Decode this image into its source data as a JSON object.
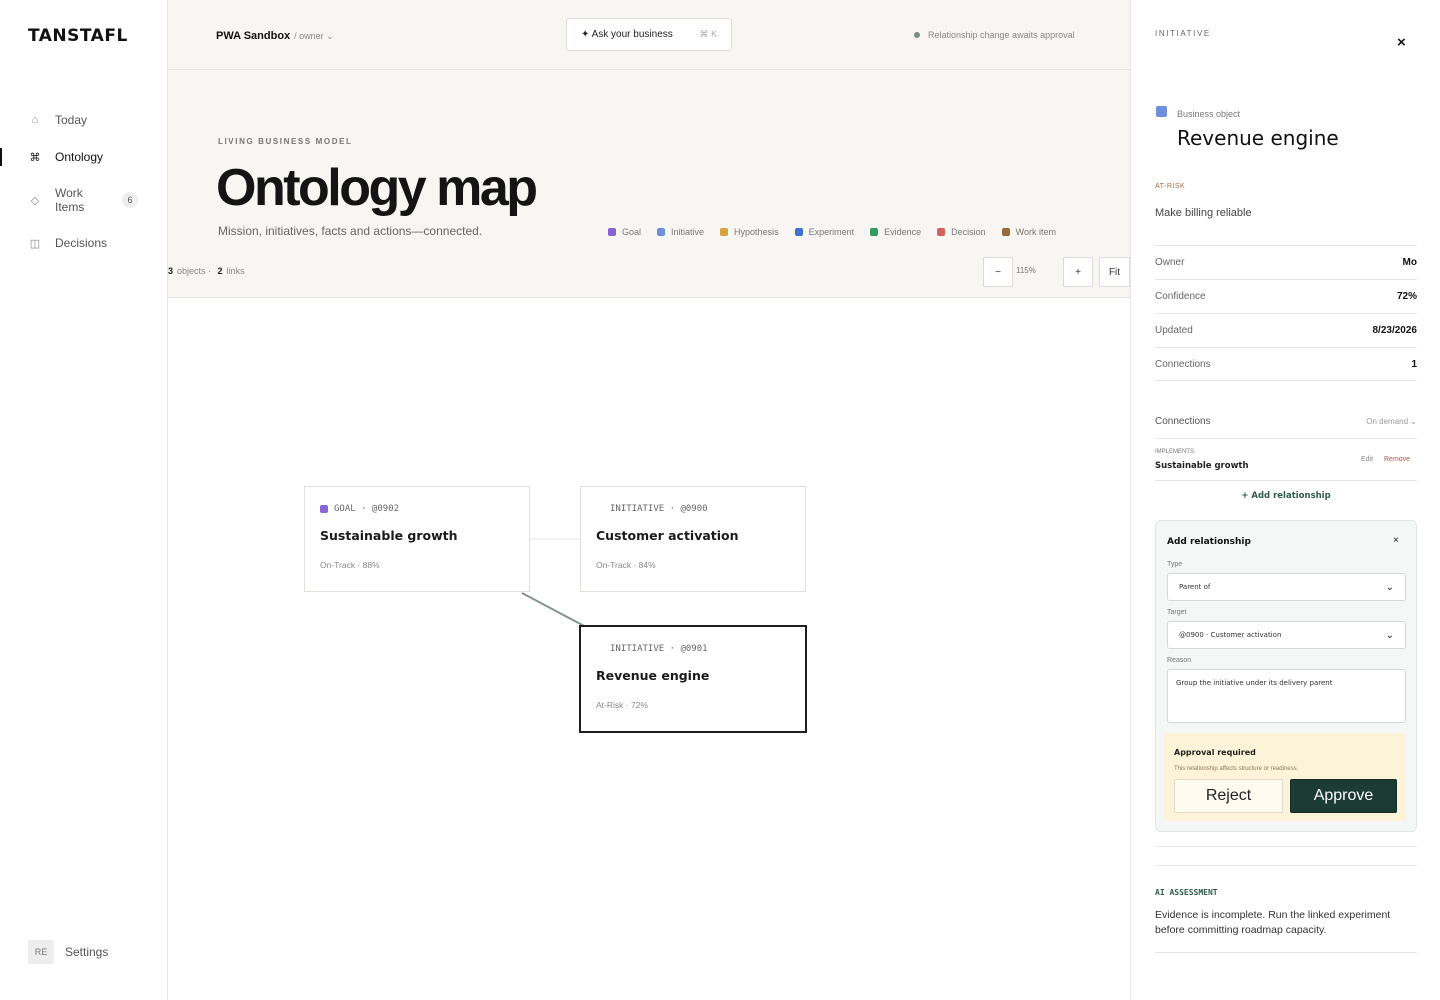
{
  "app": {
    "logo": "TANSTAFL"
  },
  "sidebar": {
    "items": [
      {
        "label": "Today",
        "icon": "home-icon",
        "glyph": "⌂"
      },
      {
        "label": "Ontology",
        "icon": "command-icon",
        "glyph": "⌘"
      },
      {
        "label_line1": "Work",
        "label_line2": "Items",
        "icon": "diamond-icon",
        "glyph": "◇",
        "badge": "6"
      },
      {
        "label": "Decisions",
        "icon": "book-icon",
        "glyph": "◫"
      }
    ],
    "active": "Ontology",
    "settings": {
      "avatar": "RE",
      "label": "Settings"
    }
  },
  "topbar": {
    "workspace": "PWA Sandbox",
    "role": "/ owner ⌄",
    "ask_label": "✦ Ask your business",
    "ask_kbd": "⌘ K",
    "status": "Relationship change awaits approval",
    "status_color": "#7a8f85"
  },
  "page": {
    "kicker": "LIVING BUSINESS MODEL",
    "title": "Ontology map",
    "subtitle": "Mission, initiatives, facts and actions—connected."
  },
  "legend": [
    {
      "label": "Goal",
      "color": "#8a63d6"
    },
    {
      "label": "Initiative",
      "color": "#6f8fdc"
    },
    {
      "label": "Hypothesis",
      "color": "#d8a23c"
    },
    {
      "label": "Experiment",
      "color": "#3d73c9"
    },
    {
      "label": "Evidence",
      "color": "#2f9a62"
    },
    {
      "label": "Decision",
      "color": "#d45f5f"
    },
    {
      "label": "Work item",
      "color": "#9a6a3a"
    }
  ],
  "canvas": {
    "objects_count": "3",
    "objects_label": "objects ·",
    "links_count": "2",
    "links_label": "links",
    "zoom_out": "−",
    "zoom_value": "115%",
    "zoom_in": "+",
    "fit": "Fit",
    "nodes": [
      {
        "meta": "GOAL · @0902",
        "title": "Sustainable growth",
        "stat": "On-Track · 88%",
        "color": "#8a63d6",
        "selected": false
      },
      {
        "meta": "INITIATIVE · @0900",
        "title": "Customer activation",
        "stat": "On-Track · 84%",
        "color": "",
        "selected": false
      },
      {
        "meta": "INITIATIVE · @0901",
        "title": "Revenue engine",
        "stat": "At-Risk · 72%",
        "color": "",
        "selected": true
      }
    ]
  },
  "panel": {
    "kicker": "INITIATIVE",
    "close": "×",
    "type_label": "Business object",
    "type_color": "#6f8fdc",
    "title": "Revenue engine",
    "risk": "AT-RISK",
    "description": "Make billing reliable",
    "fields": [
      {
        "k": "Owner",
        "v": "Mo"
      },
      {
        "k": "Confidence",
        "v": "72%"
      },
      {
        "k": "Updated",
        "v": "8/23/2026"
      },
      {
        "k": "Connections",
        "v": "1"
      }
    ],
    "connections": {
      "label": "Connections",
      "sort": "On demand ⌄",
      "items": [
        {
          "type": "IMPLEMENTS",
          "target": "Sustainable growth",
          "edit": "Edit",
          "remove": "Remove"
        }
      ],
      "add_link": "+ Add relationship"
    },
    "add_form": {
      "title": "Add relationship",
      "close": "×",
      "type_label": "Type",
      "type_value": "Parent of",
      "target_label": "Target",
      "target_value": "@0900 · Customer activation",
      "reason_label": "Reason",
      "reason_value": "Group the initiative under its delivery parent",
      "approval_title": "Approval required",
      "approval_desc": "This relationship affects structure or readiness.",
      "reject": "Reject",
      "approve": "Approve"
    },
    "ai": {
      "kicker": "AI ASSESSMENT",
      "text": "Evidence is incomplete. Run the linked experiment before committing roadmap capacity."
    }
  }
}
